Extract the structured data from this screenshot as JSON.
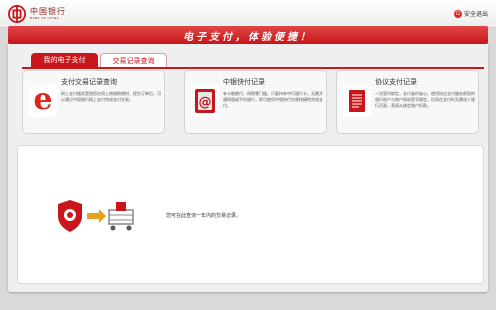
{
  "header": {
    "bank_name_cn": "中国银行",
    "bank_name_en": "BANK OF CHINA",
    "exit_label": "安全退出"
  },
  "banner": {
    "slogan": "电子支付，体验便捷！"
  },
  "tabs": [
    {
      "label": "我的电子支付",
      "active": true
    },
    {
      "label": "交易记录查询",
      "active": false
    }
  ],
  "cards": [
    {
      "title": "支付交易记录查询",
      "icon": "e-letter-icon",
      "description": "网上支付服务是指您在网上商城购物时，提交订单后，可以通过中国银行网上支付完成支付交易。"
    },
    {
      "title": "中银快付记录",
      "icon": "card-at-icon",
      "description": "有卡能都付，网购零门槛。只要持有中行银行卡，无需开通网银或手机银行，即可使用中银快付方便快捷地完成支付。"
    },
    {
      "title": "协议支付记录",
      "icon": "document-icon",
      "description": "一次签约绑定，支付省时省心。使用协议支付服务前您的银行账户与商户网站签号绑定，后续在支付时无需进入银行页面，直接从绑定账户扣款。"
    }
  ],
  "content": {
    "hint": "您可在此查询一年内的交易记录。"
  },
  "colors": {
    "brand_red": "#c8161b"
  }
}
